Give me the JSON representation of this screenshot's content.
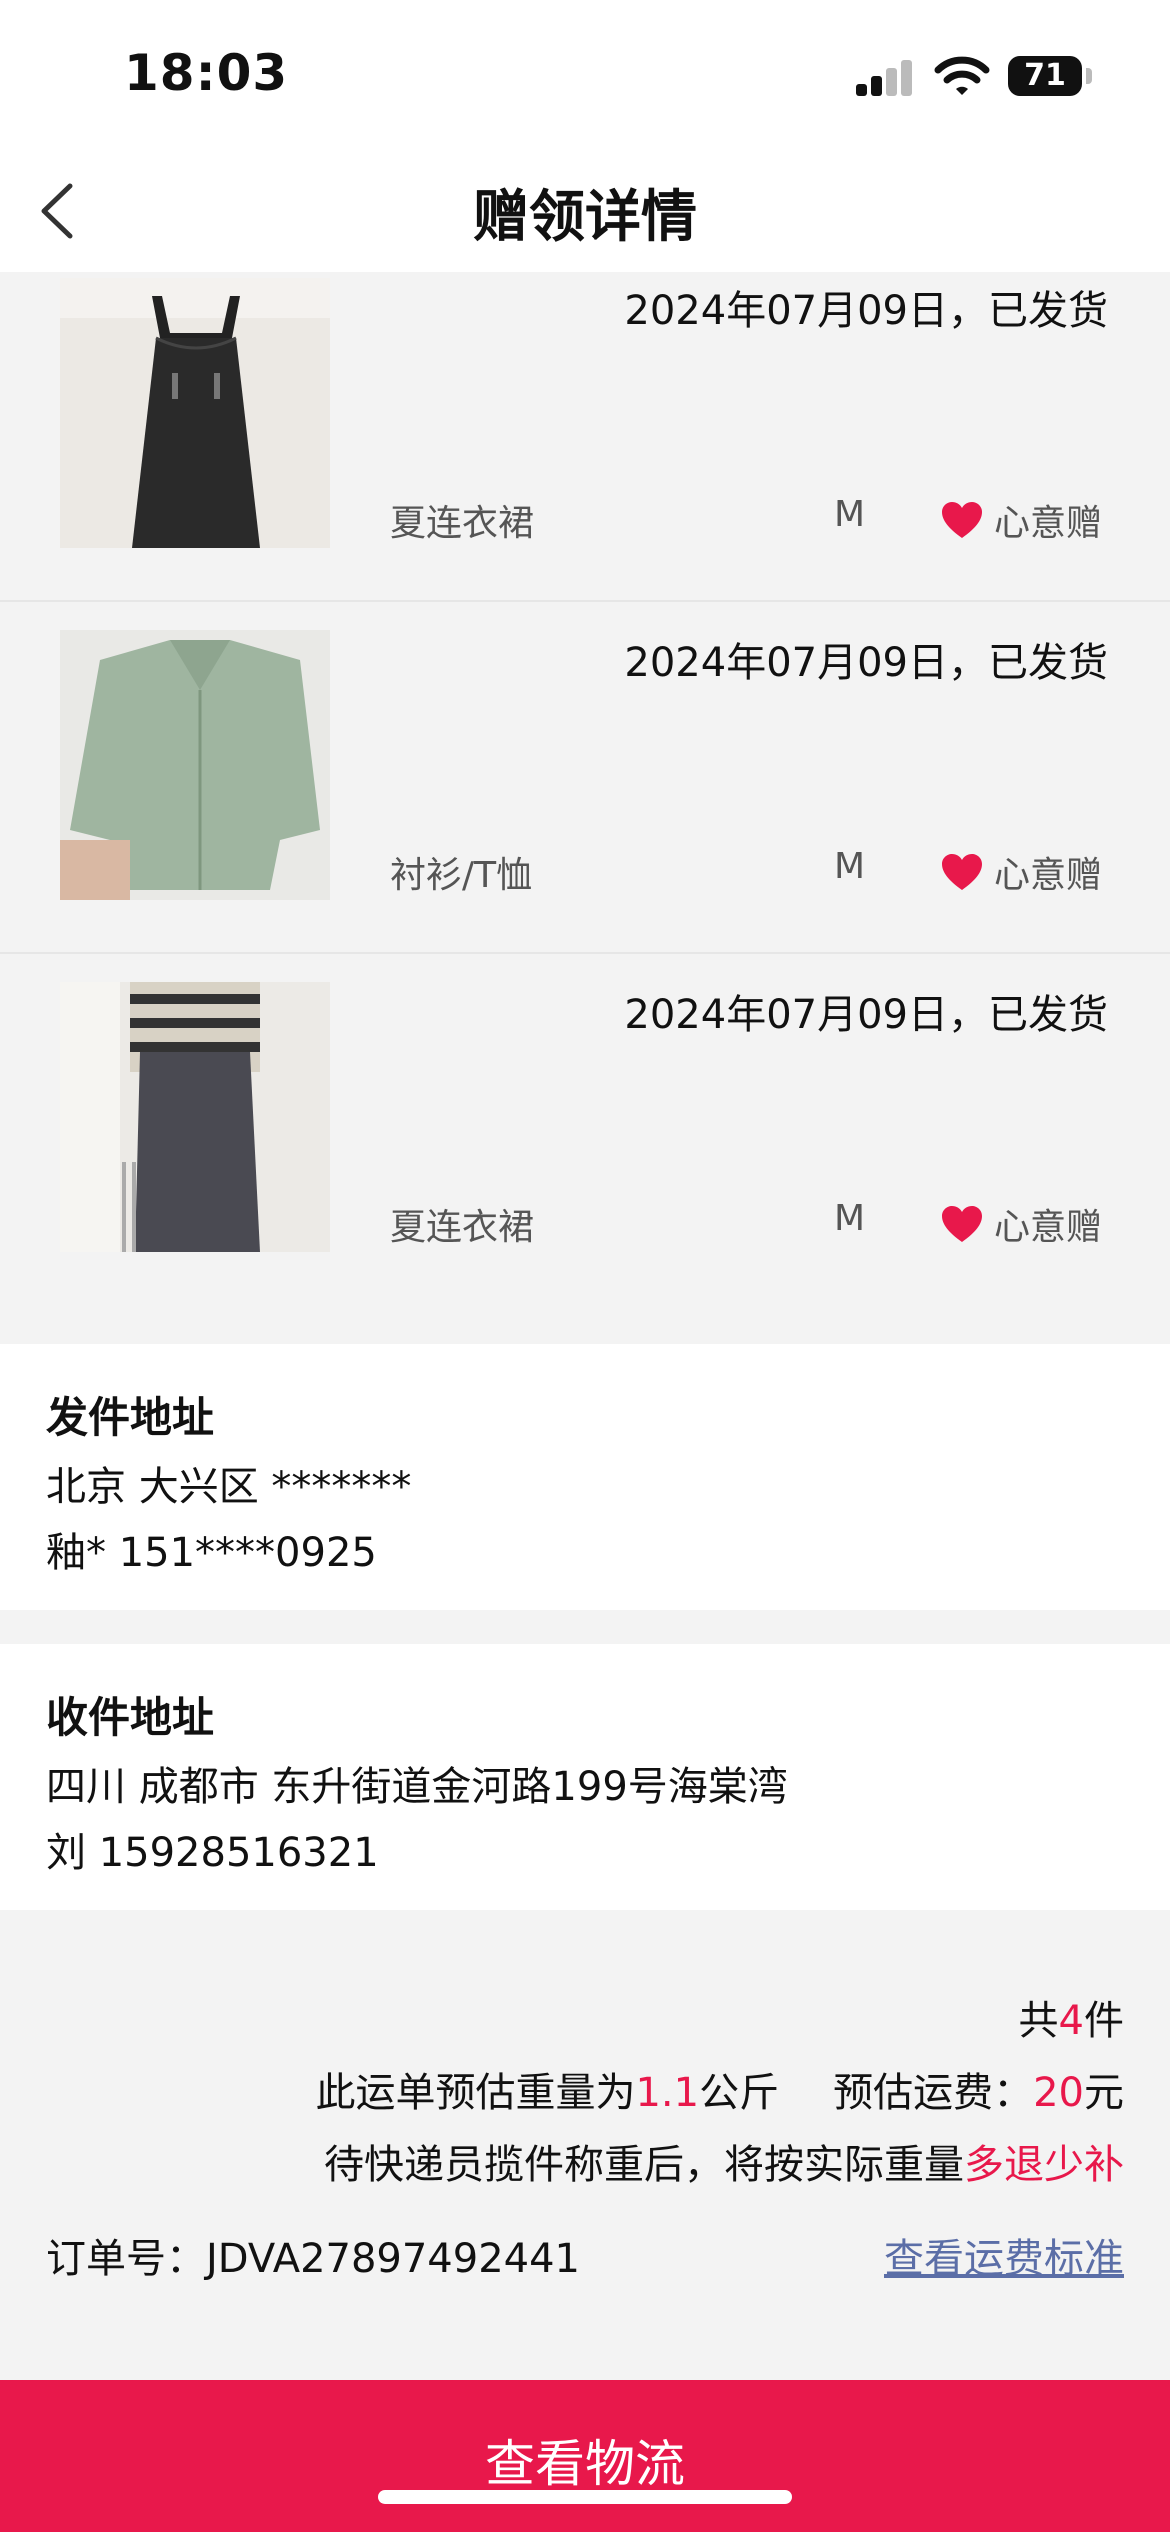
{
  "status_bar": {
    "time": "18:03",
    "battery": "71"
  },
  "nav": {
    "title": "赠领详情"
  },
  "items": [
    {
      "date_status": "2024年07月09日，已发货",
      "name": "夏连衣裙",
      "size": "M",
      "tag": "心意赠",
      "image": "black-pinafore-dress-photo"
    },
    {
      "date_status": "2024年07月09日，已发货",
      "name": "衬衫/T恤",
      "size": "M",
      "tag": "心意赠",
      "image": "mint-green-shirt-photo"
    },
    {
      "date_status": "2024年07月09日，已发货",
      "name": "夏连衣裙",
      "size": "M",
      "tag": "心意赠",
      "image": "striped-top-dark-skirt-dress-photo"
    }
  ],
  "sender": {
    "title": "发件地址",
    "address": "北京 大兴区 *******",
    "contact": "釉* 151****0925"
  },
  "receiver": {
    "title": "收件地址",
    "address": "四川 成都市 东升街道金河路199号海棠湾",
    "contact": "刘 15928516321"
  },
  "summary": {
    "count_prefix": "共",
    "count": "4",
    "count_suffix": "件",
    "weight_prefix": "此运单预估重量为",
    "weight": "1.1",
    "weight_suffix": "公斤",
    "fee_prefix": "预估运费：",
    "fee": "20",
    "fee_suffix": "元",
    "note_prefix": "待快递员揽件称重后，将按实际重量",
    "note_highlight": "多退少补",
    "order_label": "订单号：",
    "order_number": "JDVA27897492441",
    "fee_link": "查看运费标准"
  },
  "bottom_button": "查看物流",
  "colors": {
    "accent": "#e8184b",
    "link": "#5b6ea7",
    "background": "#f3f3f3"
  }
}
